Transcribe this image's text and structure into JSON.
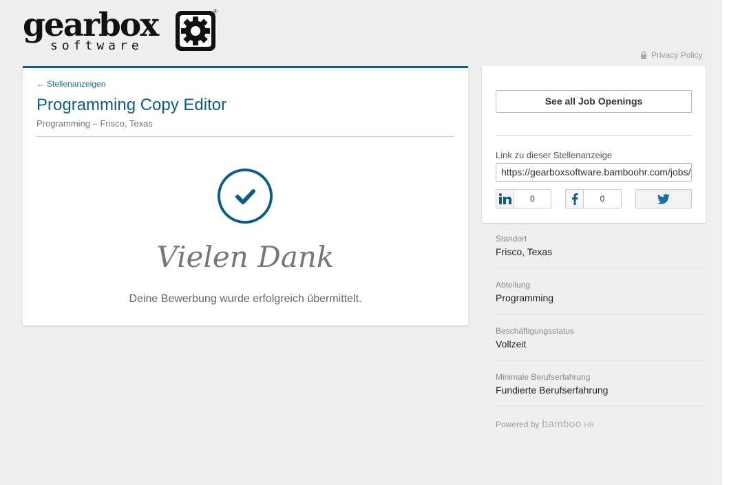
{
  "brand": {
    "wordmark": "gearbox",
    "tagline": "software",
    "registered": "®"
  },
  "header": {
    "privacy_label": "Privacy Policy"
  },
  "job": {
    "back_label": "Stellenanzeigen",
    "title": "Programming Copy Editor",
    "subtitle": "Programming – Frisco, Texas"
  },
  "confirmation": {
    "heading": "Vielen Dank",
    "message": "Deine Bewerbung wurde erfolgreich übermittelt."
  },
  "sidebar": {
    "see_all_label": "See all Job Openings",
    "link_label": "Link zu dieser Stellenanzeige",
    "link_value": "https://gearboxsoftware.bamboohr.com/jobs/view.php?id=",
    "linkedin_count": "0",
    "facebook_count": "0"
  },
  "meta": [
    {
      "label": "Standort",
      "value": "Frisco, Texas"
    },
    {
      "label": "Abteilung",
      "value": "Programming"
    },
    {
      "label": "Beschäftigungsstatus",
      "value": "Vollzeit"
    },
    {
      "label": "Minimale Berufserfahrung",
      "value": "Fundierte Berufserfahrung"
    }
  ],
  "footer": {
    "powered_label": "Powered by",
    "bamboo": "bamboo",
    "hr": "HR"
  },
  "colors": {
    "accent": "#0b5d87",
    "link": "#1b6ea5",
    "background": "#efefef"
  },
  "icons": [
    "gear-icon",
    "lock-icon",
    "arrow-left-icon",
    "checkmark-icon",
    "linkedin-icon",
    "facebook-icon",
    "twitter-icon"
  ]
}
